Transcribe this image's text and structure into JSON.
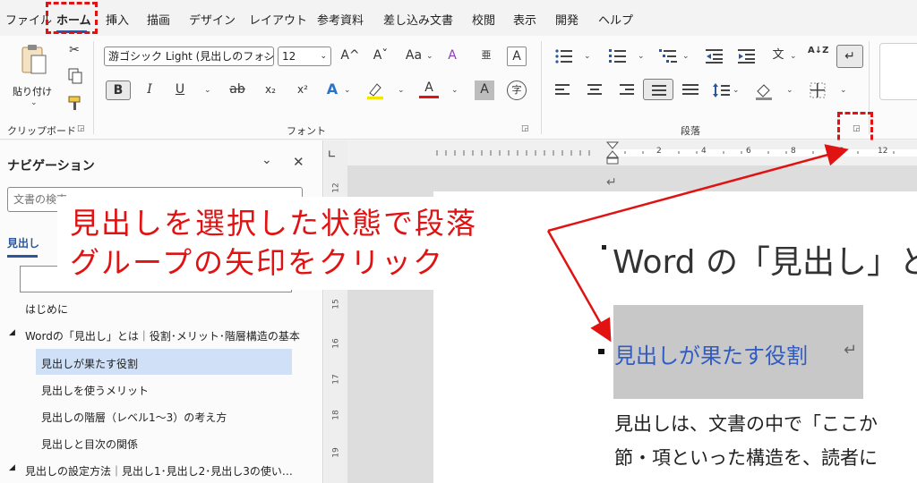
{
  "tabs": [
    {
      "label": "ファイル"
    },
    {
      "label": "ホーム"
    },
    {
      "label": "挿入"
    },
    {
      "label": "描画"
    },
    {
      "label": "デザイン"
    },
    {
      "label": "レイアウト"
    },
    {
      "label": "参考資料"
    },
    {
      "label": "差し込み文書"
    },
    {
      "label": "校閲"
    },
    {
      "label": "表示"
    },
    {
      "label": "開発"
    },
    {
      "label": "ヘルプ"
    }
  ],
  "ribbon": {
    "clipboard": {
      "group_label": "クリップボード",
      "paste_label": "貼り付け"
    },
    "font": {
      "group_label": "フォント",
      "font_name": "游ゴシック Light (見出しのフォン",
      "font_size": "12",
      "grow": "A^",
      "shrink": "Aˇ",
      "case": "Aa",
      "bold": "B",
      "italic": "I",
      "underline": "U",
      "strike": "ab",
      "subscript": "x₂",
      "superscript": "x²",
      "effects": "A",
      "font_color": "A",
      "shading": "A",
      "enclose": "字",
      "clear": "A",
      "char_border": "A"
    },
    "paragraph": {
      "group_label": "段落",
      "sort": "A↓Z"
    }
  },
  "colors": {
    "accent": "#2b579a",
    "annotation_red": "#e01212",
    "heading_blue": "#2f5bc4",
    "selected_nav": "#cfe0f7"
  },
  "nav": {
    "title": "ナビゲーション",
    "search_placeholder": "文書の検索",
    "tab_headings": "見出し",
    "items": [
      {
        "label": "はじめに"
      },
      {
        "label": "Wordの「見出し」とは｜役割･メリット･階層構造の基本"
      },
      {
        "label": "見出しが果たす役割"
      },
      {
        "label": "見出しを使うメリット"
      },
      {
        "label": "見出しの階層（レベル1〜3）の考え方"
      },
      {
        "label": "見出しと目次の関係"
      },
      {
        "label": "見出しの設定方法｜見出し1･見出し2･見出し3の使い…"
      }
    ]
  },
  "ruler": {
    "h_numbers": [
      "2",
      "4",
      "6",
      "8",
      "10",
      "12"
    ],
    "v_numbers": [
      "12",
      "13",
      "14",
      "15",
      "16",
      "17",
      "18",
      "19"
    ]
  },
  "document": {
    "title_line": "Word の「見出し」と",
    "heading2": "見出しが果たす役割",
    "body_line1": "見出しは、文書の中で「ここか",
    "body_line2": "節・項といった構造を、読者に"
  },
  "annotation": {
    "line1": "見出しを選択した状態で段落",
    "line2": "グループの矢印をクリック"
  }
}
